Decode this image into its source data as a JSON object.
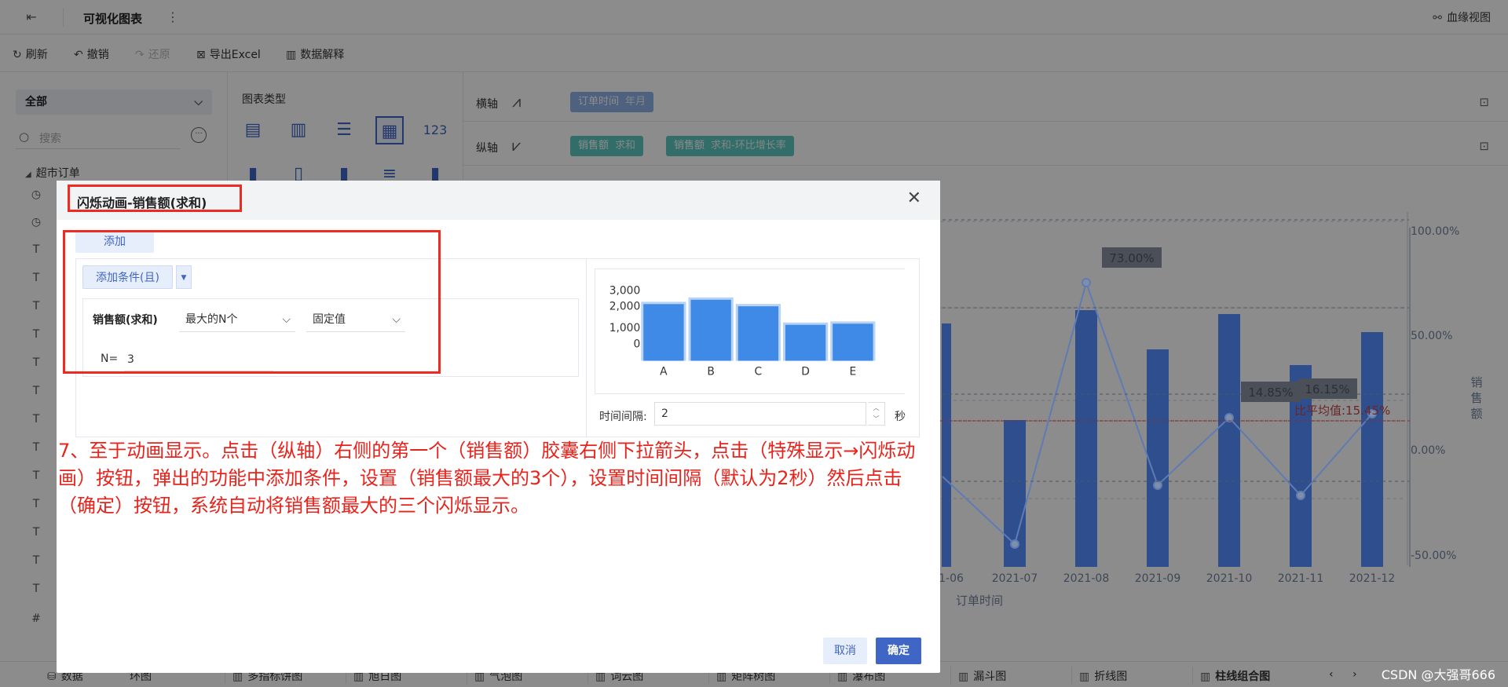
{
  "topbar": {
    "title": "可视化图表",
    "lineage": "血缘视图"
  },
  "toolbar": {
    "refresh": "刷新",
    "undo": "撤销",
    "redo": "还原",
    "export": "导出Excel",
    "explain": "数据解释"
  },
  "left": {
    "select": "全部",
    "search_placeholder": "搜索",
    "tree_root": "超市订单"
  },
  "charttype": {
    "title": "图表类型",
    "number_icon": "123"
  },
  "axes": {
    "x_label": "横轴",
    "y_label": "纵轴",
    "x_pill": {
      "field": "订单时间",
      "sub": "年月"
    },
    "y_pills": [
      {
        "field": "销售额",
        "sub": "求和"
      },
      {
        "field": "销售额",
        "sub": "求和-环比增长率"
      }
    ]
  },
  "main_chart": {
    "x_ticks": [
      "1-06",
      "2021-07",
      "2021-08",
      "2021-09",
      "2021-10",
      "2021-11",
      "2021-12"
    ],
    "x_title": "订单时间",
    "y_right_ticks": [
      "100.00%",
      "50.00%",
      "0.00%",
      "-50.00%"
    ],
    "y_right_title": "销售额",
    "labels": [
      "73.00%",
      "14.85%",
      "16.15%"
    ],
    "avg_label": "比平均值:15.45%"
  },
  "bottom_tabs": [
    "数据",
    "环图",
    "多指标饼图",
    "旭日图",
    "气泡图",
    "词云图",
    "矩阵树图",
    "瀑布图",
    "漏斗图",
    "折线图",
    "柱线组合图"
  ],
  "modal": {
    "title": "闪烁动画-销售额(求和)",
    "tab_add": "添加",
    "add_condition": "添加条件(且)",
    "condition": {
      "field": "销售额(求和)",
      "op": "最大的N个",
      "value_type": "固定值",
      "n_label": "N=",
      "n_value": "3"
    },
    "interval_label": "时间间隔:",
    "interval_value": "2",
    "interval_unit": "秒",
    "cancel": "取消",
    "ok": "确定"
  },
  "preview_chart": {
    "type": "bar",
    "categories": [
      "A",
      "B",
      "C",
      "D",
      "E"
    ],
    "values": [
      2600,
      2800,
      2500,
      1650,
      1700
    ],
    "y_ticks": [
      "3,000",
      "2,000",
      "1,000",
      "0"
    ],
    "ylim": [
      0,
      3200
    ]
  },
  "annotation": "7、至于动画显示。点击（纵轴）右侧的第一个（销售额）胶囊右侧下拉箭头，点击（特殊显示→闪烁动画）按钮，弹出的功能中添加条件，设置（销售额最大的3个），设置时间间隔（默认为2秒）然后点击（确定）按钮，系统自动将销售额最大的三个闪烁显示。",
  "watermark": "CSDN @大强哥666",
  "colors": {
    "primary": "#3f66c5",
    "bar": "#4472c4",
    "annotation_red": "#e8231c",
    "pill_x": "#8fb1e8",
    "pill_y": "#5cc6c2"
  }
}
